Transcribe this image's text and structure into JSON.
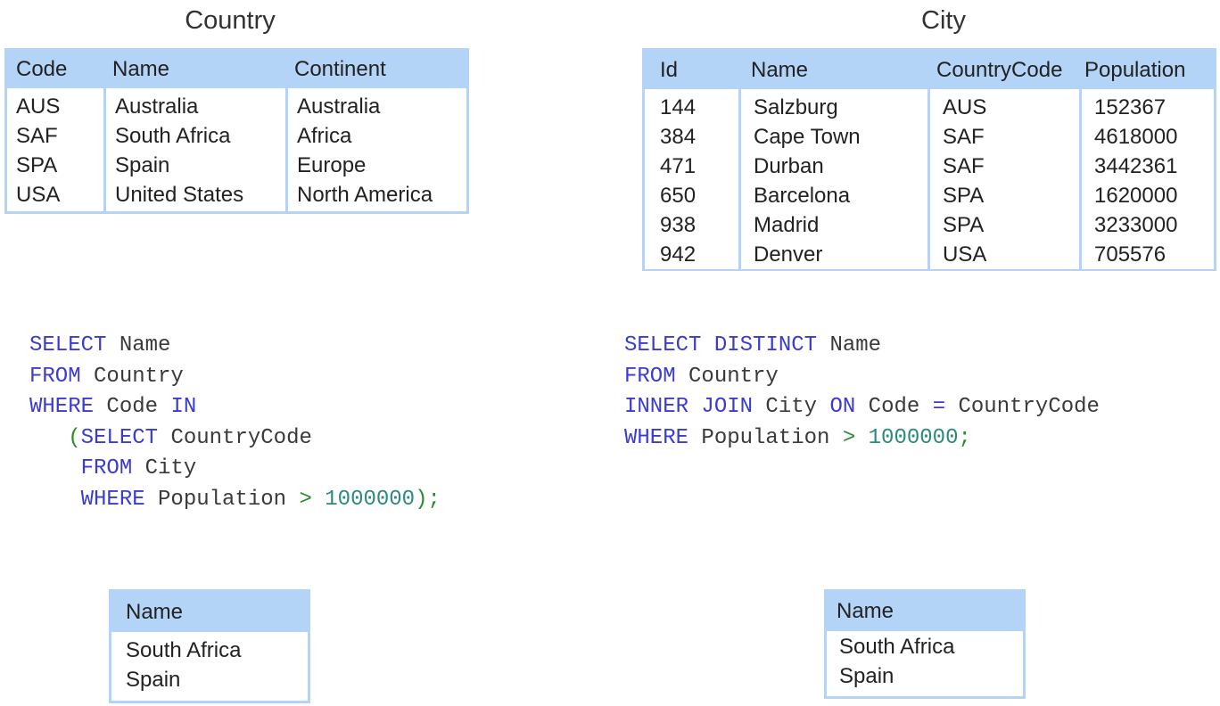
{
  "country_table": {
    "caption": "Country",
    "headers": [
      "Code",
      "Name",
      "Continent"
    ],
    "rows": [
      [
        "AUS",
        "Australia",
        "Australia"
      ],
      [
        "SAF",
        "South Africa",
        "Africa"
      ],
      [
        "SPA",
        "Spain",
        "Europe"
      ],
      [
        "USA",
        "United States",
        "North America"
      ]
    ]
  },
  "city_table": {
    "caption": "City",
    "headers": [
      "Id",
      "Name",
      "CountryCode",
      "Population"
    ],
    "rows": [
      [
        "144",
        "Salzburg",
        "AUS",
        "152367"
      ],
      [
        "384",
        "Cape Town",
        "SAF",
        "4618000"
      ],
      [
        "471",
        "Durban",
        "SAF",
        "3442361"
      ],
      [
        "650",
        "Barcelona",
        "SPA",
        "1620000"
      ],
      [
        "938",
        "Madrid",
        "SPA",
        "3233000"
      ],
      [
        "942",
        "Denver",
        "USA",
        "705576"
      ]
    ]
  },
  "query_subquery": {
    "lines": [
      "SELECT Name",
      "FROM Country",
      "WHERE Code IN",
      "   (SELECT CountryCode",
      "    FROM City",
      "    WHERE Population > 1000000);"
    ]
  },
  "query_join": {
    "lines": [
      "SELECT DISTINCT Name",
      "FROM Country",
      "INNER JOIN City ON Code = CountryCode",
      "WHERE Population > 1000000;"
    ]
  },
  "result_subquery": {
    "header": "Name",
    "rows": [
      "South Africa",
      "Spain"
    ]
  },
  "result_join": {
    "header": "Name",
    "rows": [
      "South Africa",
      "Spain"
    ]
  },
  "colors": {
    "table_header": "#b3d4f6",
    "keyword": "#3b3bd1",
    "operator": "#2c8c2c",
    "number": "#2a8a7e",
    "identifier": "#3a3a3a"
  }
}
